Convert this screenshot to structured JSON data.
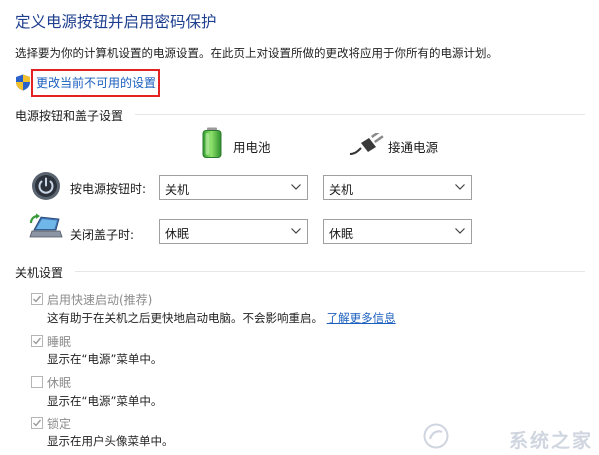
{
  "page": {
    "title": "定义电源按钮并启用密码保护",
    "description": "选择要为你的计算机设置的电源设置。在此页上对设置所做的更改将应用于你所有的电源计划。",
    "change_link": "更改当前不可用的设置"
  },
  "power_section": {
    "title": "电源按钮和盖子设置",
    "columns": {
      "battery": "用电池",
      "plugged": "接通电源"
    },
    "rows": [
      {
        "label": "按电源按钮时:",
        "battery_value": "关机",
        "plugged_value": "关机"
      },
      {
        "label": "关闭盖子时:",
        "battery_value": "休眠",
        "plugged_value": "休眠"
      }
    ]
  },
  "shutdown_section": {
    "title": "关机设置",
    "items": [
      {
        "label": "启用快速启动(推荐)",
        "checked": true,
        "desc": "这有助于在关机之后更快地启动电脑。不会影响重启。",
        "link": "了解更多信息"
      },
      {
        "label": "睡眠",
        "checked": true,
        "desc": "显示在“电源”菜单中。"
      },
      {
        "label": "休眠",
        "checked": false,
        "desc": "显示在“电源”菜单中。"
      },
      {
        "label": "锁定",
        "checked": true,
        "desc": "显示在用户头像菜单中。"
      }
    ]
  },
  "watermark": {
    "text": "系统之家"
  },
  "colors": {
    "title": "#1e3f8f",
    "link": "#1a5fbf",
    "highlight": "#e32222"
  }
}
